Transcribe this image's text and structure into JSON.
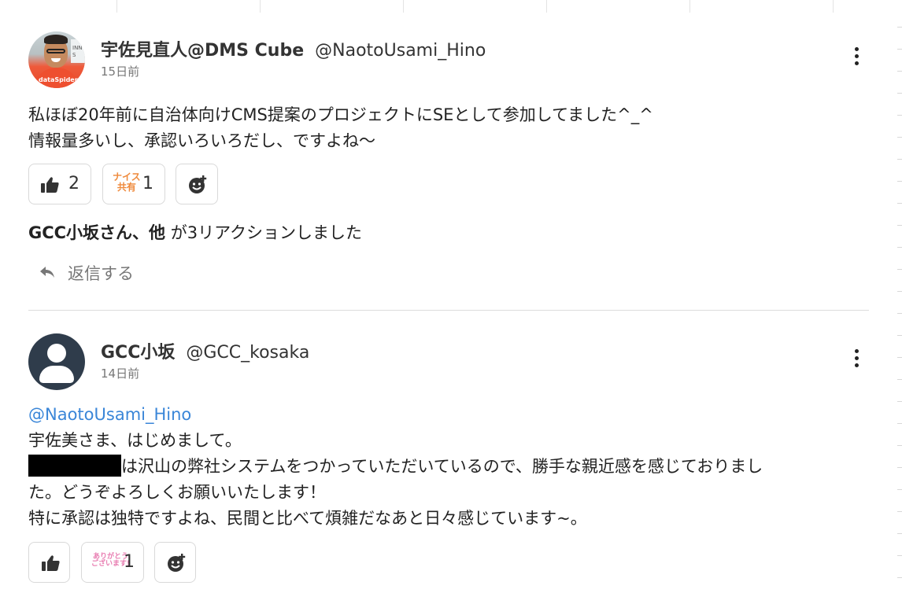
{
  "comments": [
    {
      "author": "宇佐見直人@DMS Cube",
      "handle": "@NaotoUsami_Hino",
      "time": "15日前",
      "avatar_shirt_text": "dataSpider",
      "avatar_banner_text": "INN S",
      "lines": [
        "私ほぼ20年前に自治体向けCMS提案のプロジェクトにSEとして参加してました^_^",
        "情報量多いし、承認いろいろだし、ですよね〜"
      ],
      "reactions": {
        "like_count": "2",
        "stamp_line1": "ナイス",
        "stamp_line2": "共有",
        "stamp_count": "1",
        "add_icon": "emoji-add-icon"
      },
      "summary_bold": "GCC小坂さん、他",
      "summary_rest": " が3リアクションしました",
      "reply_label": "返信する"
    },
    {
      "author": "GCC小坂",
      "handle": "@GCC_kosaka",
      "time": "14日前",
      "mention": "@NaotoUsami_Hino",
      "line1": "宇佐美さま、はじめまして。",
      "line2_after_redaction": "は沢山の弊社システムをつかっていただいているので、勝手な親近感を感じておりまし",
      "line3": "た。どうぞよろしくお願いいたします！",
      "line4": "特に承認は独特ですよね、民間と比べて煩雑だなあと日々感じています~。",
      "reactions": {
        "like_count": "",
        "stamp_line1": "ありがとう",
        "stamp_line2": "ございます!",
        "stamp_count": "1",
        "add_icon": "emoji-add-icon"
      }
    }
  ],
  "colors": {
    "mention": "#3a86d8",
    "stamp_orange": "#ef8a3c",
    "stamp_pink": "#e87bb0",
    "avatar_default_bg": "#2f3c4b"
  }
}
